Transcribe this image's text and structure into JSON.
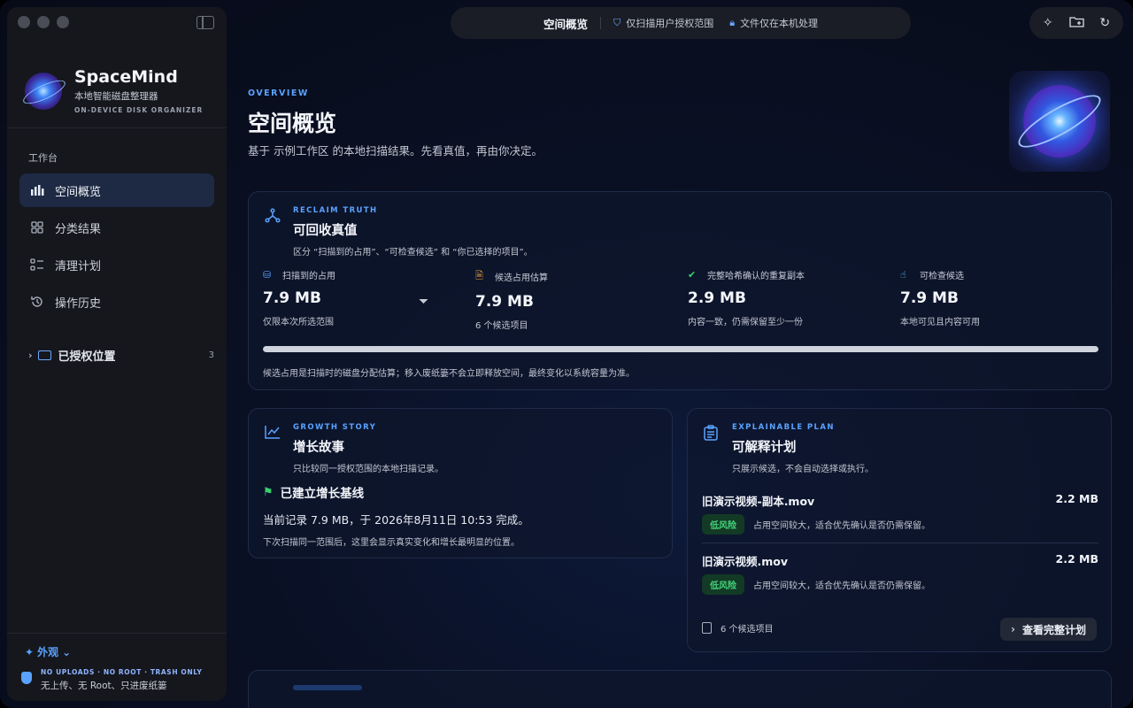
{
  "app": {
    "name": "SpaceMind",
    "subtitle": "本地智能磁盘整理器",
    "tagline": "ON-DEVICE DISK ORGANIZER"
  },
  "toolbar": {
    "title": "空间概览",
    "scope": "仅扫描用户授权范围",
    "local": "文件仅在本机处理",
    "icons": [
      "sparkle-icon",
      "folder-add-icon",
      "refresh-icon"
    ]
  },
  "sidebar": {
    "section": "工作台",
    "items": [
      {
        "label": "空间概览",
        "icon": "bar-chart-icon",
        "active": true
      },
      {
        "label": "分类结果",
        "icon": "grid-icon",
        "active": false
      },
      {
        "label": "清理计划",
        "icon": "checklist-icon",
        "active": false
      },
      {
        "label": "操作历史",
        "icon": "history-icon",
        "active": false
      }
    ],
    "authorized": {
      "label": "已授权位置",
      "count": "3"
    },
    "appearance": "外观",
    "privacy_tag": "NO UPLOADS · NO ROOT · TRASH ONLY",
    "privacy_text": "无上传、无 Root、只进废纸篓"
  },
  "header": {
    "tag": "OVERVIEW",
    "title": "空间概览",
    "subtitle": "基于 示例工作区 的本地扫描结果。先看真值，再由你决定。"
  },
  "reclaim": {
    "tag": "RECLAIM TRUTH",
    "title": "可回收真值",
    "subtitle": "区分 “扫描到的占用”、“可检查候选” 和 “你已选择的项目”。",
    "metrics": [
      {
        "label": "扫描到的占用",
        "value": "7.9 MB",
        "note": "仅限本次所选范围",
        "color": "#5aa2ff"
      },
      {
        "label": "候选占用估算",
        "value": "7.9 MB",
        "note": "6 个候选项目",
        "color": "#f0a23a"
      },
      {
        "label": "完整哈希确认的重复副本",
        "value": "2.9 MB",
        "note": "内容一致，仍需保留至少一份",
        "color": "#3ccf6e"
      },
      {
        "label": "可检查候选",
        "value": "7.9 MB",
        "note": "本地可见且内容可用",
        "color": "#5ad0ff"
      }
    ],
    "progress": 1.0,
    "footer": "候选占用是扫描时的磁盘分配估算；移入废纸篓不会立即释放空间，最终变化以系统容量为准。"
  },
  "growth": {
    "tag": "GROWTH STORY",
    "title": "增长故事",
    "subtitle": "只比较同一授权范围的本地扫描记录。",
    "heading": "已建立增长基线",
    "line": "当前记录 7.9 MB，于 2026年8月11日 10:53 完成。",
    "footer": "下次扫描同一范围后，这里会显示真实变化和增长最明显的位置。"
  },
  "plan": {
    "tag": "EXPLAINABLE PLAN",
    "title": "可解释计划",
    "subtitle": "只展示候选，不会自动选择或执行。",
    "items": [
      {
        "name": "旧演示视频-副本.mov",
        "size": "2.2 MB",
        "risk": "低风险",
        "desc": "占用空间较大，适合优先确认是否仍需保留。"
      },
      {
        "name": "旧演示视频.mov",
        "size": "2.2 MB",
        "risk": "低风险",
        "desc": "占用空间较大，适合优先确认是否仍需保留。"
      }
    ],
    "count": "6 个候选项目",
    "button": "查看完整计划"
  }
}
